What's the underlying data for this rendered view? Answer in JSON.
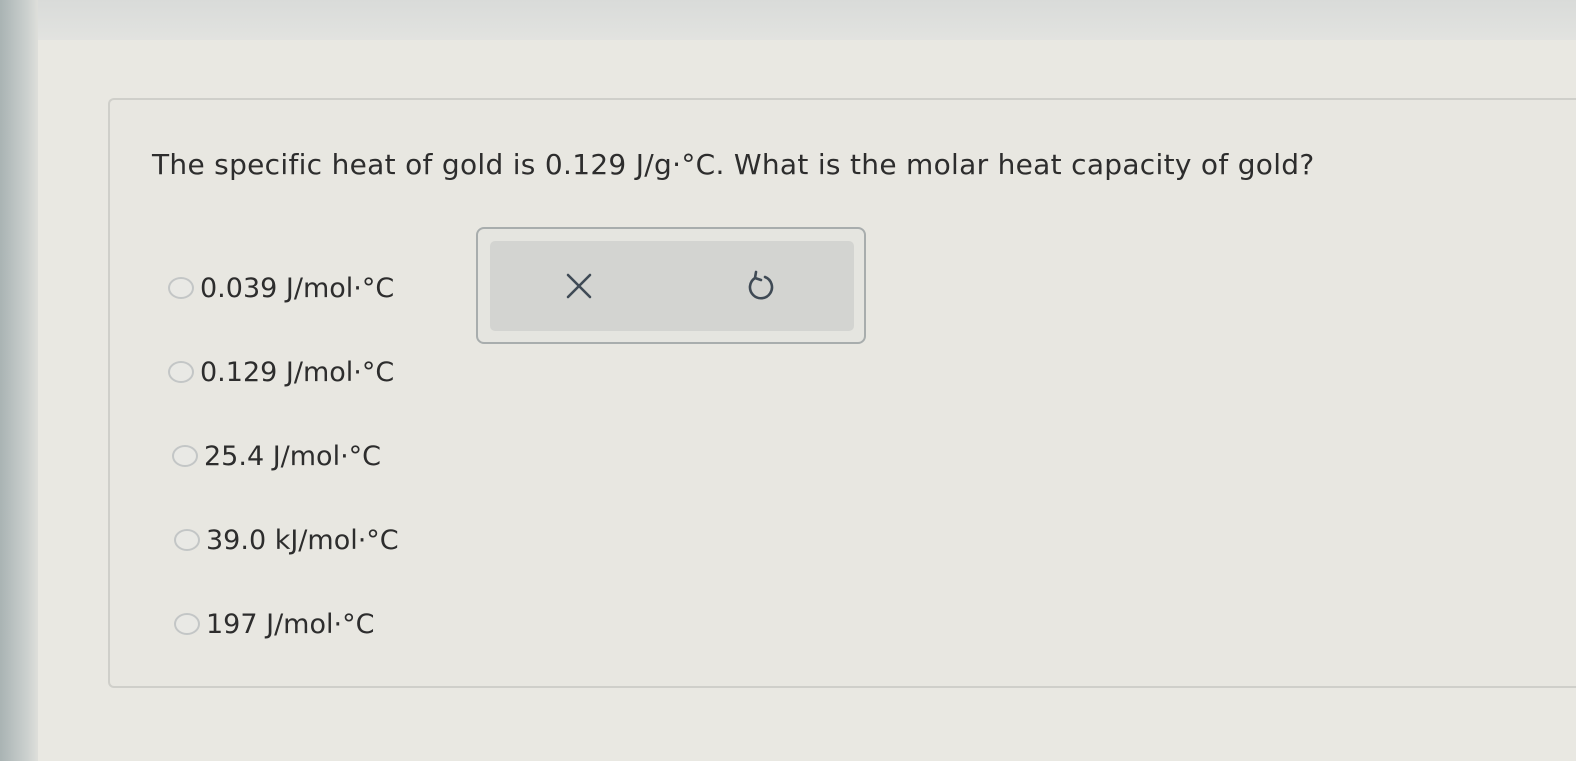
{
  "question": {
    "text": "The specific heat of gold is 0.129 J/g·°C. What is the molar heat capacity of gold?"
  },
  "options": [
    {
      "label": "0.039 J/mol·°C",
      "selected": false
    },
    {
      "label": "0.129 J/mol·°C",
      "selected": false
    },
    {
      "label": "25.4 J/mol·°C",
      "selected": false
    },
    {
      "label": "39.0 kJ/mol·°C",
      "selected": false
    },
    {
      "label": "197 J/mol·°C",
      "selected": false
    }
  ],
  "toolbar": {
    "icons": [
      "close-icon",
      "undo-icon"
    ]
  },
  "colors": {
    "text": "#2d2d2d",
    "background": "#e8e7e1",
    "panel": "#d3d4d1"
  }
}
